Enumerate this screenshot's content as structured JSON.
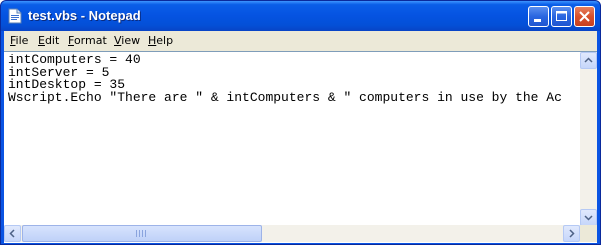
{
  "window": {
    "title": "test.vbs - Notepad",
    "app_icon": "notepad-document-icon",
    "controls": [
      "minimize-icon",
      "maximize-icon",
      "close-icon"
    ]
  },
  "menubar": {
    "items": [
      {
        "key": "F",
        "rest": "ile"
      },
      {
        "key": "E",
        "rest": "dit"
      },
      {
        "key": "F",
        "rest": "ormat",
        "pre": ""
      },
      {
        "key": "V",
        "rest": "iew"
      },
      {
        "key": "H",
        "rest": "elp"
      }
    ]
  },
  "editor": {
    "lines": [
      "intComputers = 40",
      "intServer = 5",
      "intDesktop = 35",
      "Wscript.Echo \"There are \" & intComputers & \" computers in use by the Ac"
    ]
  },
  "colors": {
    "titlebar": "#0553e1",
    "close_button": "#d8502c",
    "window_face": "#ece9d8"
  }
}
